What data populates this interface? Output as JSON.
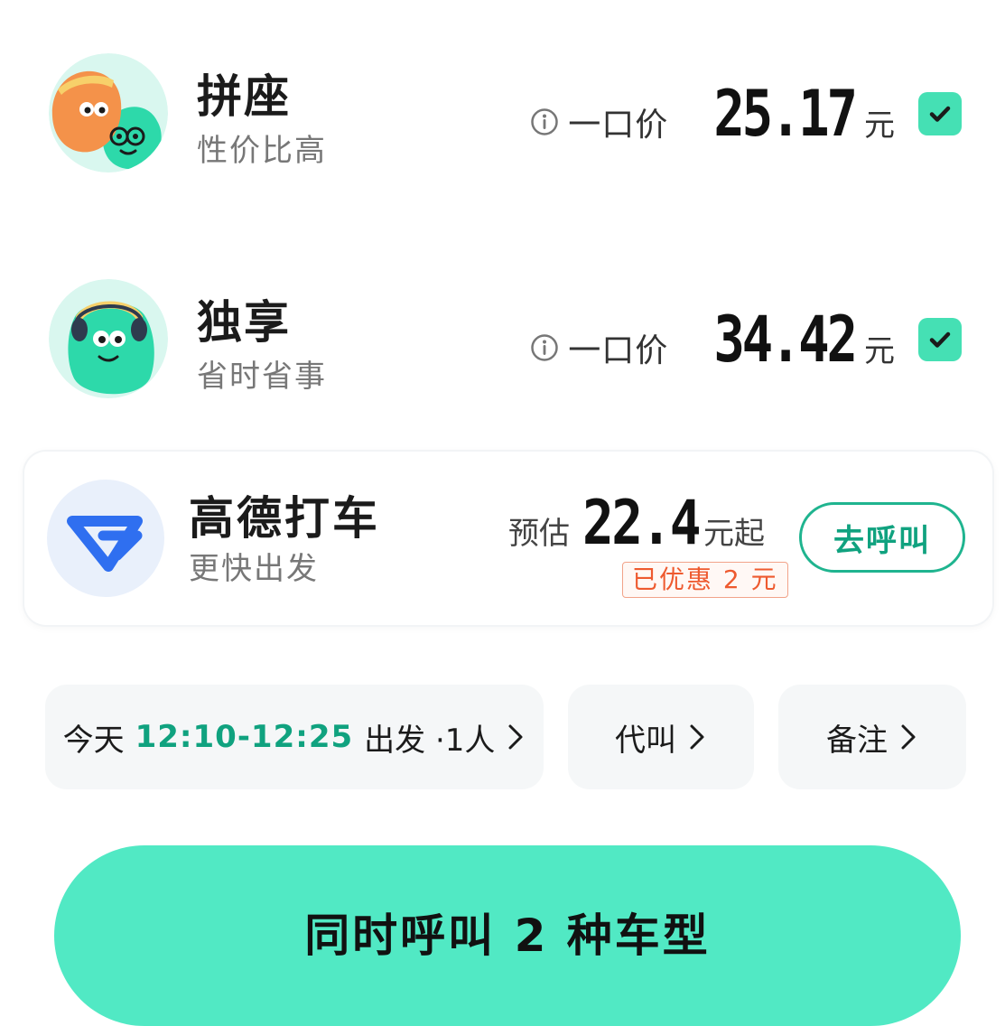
{
  "colors": {
    "accent_green": "#45e0b4",
    "primary_button": "#51e9c4",
    "time_green": "#10a27f",
    "discount_orange": "#ee5a2f"
  },
  "options": [
    {
      "title": "拼座",
      "subtitle": "性价比高",
      "price_prefix": "一口价",
      "price": "25.17",
      "unit": "元",
      "checked": true
    },
    {
      "title": "独享",
      "subtitle": "省时省事",
      "price_prefix": "一口价",
      "price": "34.42",
      "unit": "元",
      "checked": true
    }
  ],
  "gaode": {
    "title": "高德打车",
    "subtitle": "更快出发",
    "price_prefix": "预估",
    "price": "22.4",
    "price_suffix": "元起",
    "discount": "已优惠 2 元",
    "call_label": "去呼叫"
  },
  "chips": {
    "time_prefix": "今天",
    "time_range": "12:10-12:25",
    "time_suffix": "出发 ·1人",
    "proxy_label": "代叫",
    "note_label": "备注"
  },
  "main_button": {
    "label": "同时呼叫 2 种车型"
  }
}
